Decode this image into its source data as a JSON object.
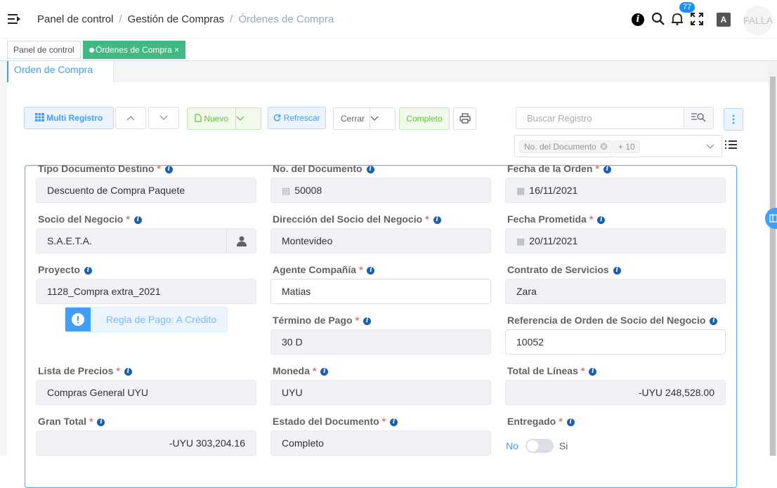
{
  "header": {
    "breadcrumb": [
      "Panel de control",
      "Gestión de Compras",
      "Órdenes de Compra"
    ],
    "notification_count": "77",
    "lang_label": "A",
    "avatar_text": "FALLA"
  },
  "tags": {
    "dashboard": "Panel de control",
    "active": "Órdenes de Compra",
    "close": "×"
  },
  "tab": {
    "label": "Orden de Compra"
  },
  "toolbar": {
    "multi": "Multi Registro",
    "new": "Nuevo",
    "refresh": "Refrescar",
    "close_action": "Cerrar",
    "complete": "Completo",
    "search_placeholder": "Buscar Registro",
    "column_chip": "No. del Documento",
    "more_chip": "+ 10"
  },
  "fields": {
    "tipo_doc": {
      "label": "Tipo Documento Destino",
      "value": "Descuento de Compra Paquete"
    },
    "no_doc": {
      "label": "No. del Documento",
      "value": "50008"
    },
    "fecha_orden": {
      "label": "Fecha de la Orden",
      "value": "16/11/2021"
    },
    "socio": {
      "label": "Socio del Negocio",
      "value": "S.A.E.T.A."
    },
    "direccion": {
      "label": "Dirección del Socio del Negocio",
      "value": "Montevideo"
    },
    "fecha_prom": {
      "label": "Fecha Prometida",
      "value": "20/11/2021"
    },
    "proyecto": {
      "label": "Proyecto",
      "value": "1128_Compra extra_2021"
    },
    "agente": {
      "label": "Agente Compañía",
      "value": "Matias"
    },
    "contrato": {
      "label": "Contrato de Servicios",
      "value": "Zara"
    },
    "regla_pago": "Regla de Pago: A Crédito",
    "termino": {
      "label": "Término de Pago",
      "value": "30 D"
    },
    "referencia": {
      "label": "Referencia de Orden de Socio del Negocio",
      "value": "10052"
    },
    "lista_precios": {
      "label": "Lista de Precios",
      "value": "Compras General UYU"
    },
    "moneda": {
      "label": "Moneda",
      "value": "UYU"
    },
    "total_lineas": {
      "label": "Total de Líneas",
      "value": "-UYU 248,528.00"
    },
    "gran_total": {
      "label": "Gran Total",
      "value": "-UYU 303,204.16"
    },
    "estado": {
      "label": "Estado del Documento",
      "value": "Completo"
    },
    "entregado": {
      "label": "Entregado",
      "off": "No",
      "on": "Si"
    }
  },
  "required_mark": "*",
  "info_mark": "i",
  "colors": {
    "accent": "#409eff",
    "success": "#42b983",
    "required": "#f56c6c"
  }
}
